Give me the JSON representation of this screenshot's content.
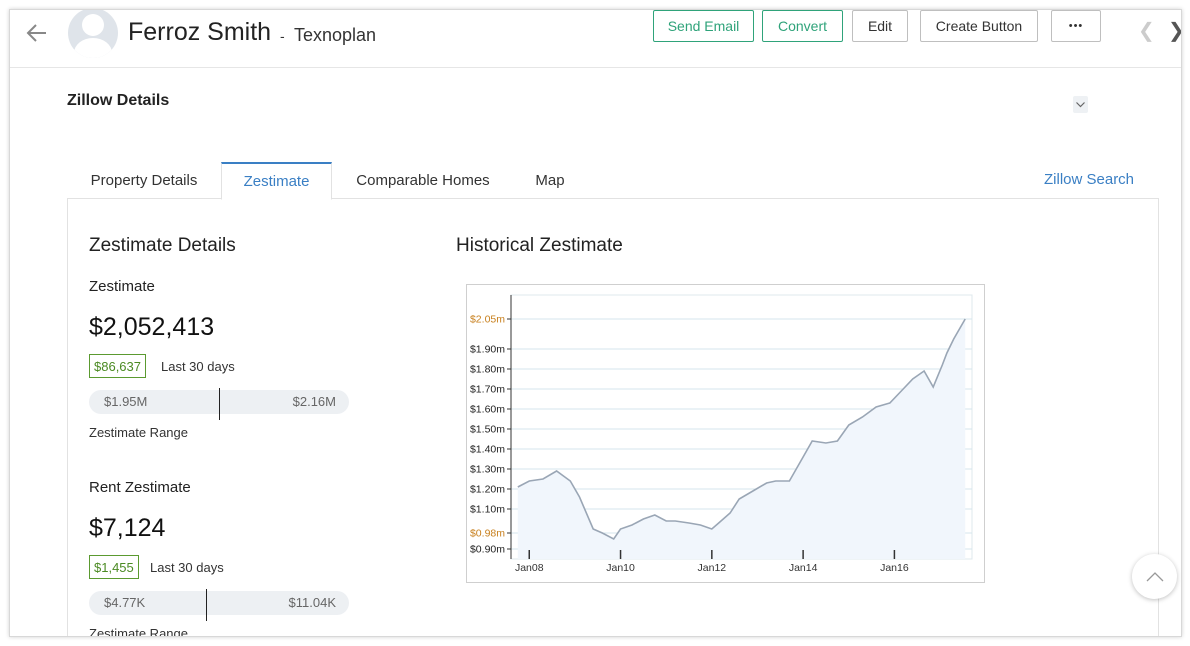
{
  "header": {
    "name": "Ferroz Smith",
    "separator": "-",
    "company": "Texnoplan",
    "buttons": {
      "send_email": "Send Email",
      "convert": "Convert",
      "edit": "Edit",
      "create_button": "Create Button",
      "more": "•••"
    },
    "colors": {
      "accent_green": "#2fa37a",
      "ribbon": "#f29b3a"
    }
  },
  "section": {
    "title": "Zillow Details"
  },
  "tabs": [
    {
      "label": "Property Details",
      "active": false
    },
    {
      "label": "Zestimate",
      "active": true
    },
    {
      "label": "Comparable Homes",
      "active": false
    },
    {
      "label": "Map",
      "active": false
    }
  ],
  "zillow_search": "Zillow Search",
  "details": {
    "heading": "Zestimate Details",
    "zestimate": {
      "label": "Zestimate",
      "value": "$2,052,413",
      "change": "$86,637",
      "period": "Last 30 days",
      "range_low": "$1.95M",
      "range_high": "$2.16M",
      "range_position": 0.5,
      "range_label": "Zestimate Range"
    },
    "rent": {
      "label": "Rent Zestimate",
      "value": "$7,124",
      "change": "$1,455",
      "period": "Last 30 days",
      "range_low": "$4.77K",
      "range_high": "$11.04K",
      "range_position": 0.45,
      "range_label": "Zestimate Range"
    }
  },
  "chart": {
    "heading": "Historical Zestimate"
  },
  "chart_data": {
    "type": "area",
    "title": "Historical Zestimate",
    "xlabel": "",
    "ylabel": "",
    "x_ticks": [
      "Jan08",
      "Jan10",
      "Jan12",
      "Jan14",
      "Jan16"
    ],
    "y_ticks": [
      "$0.90m",
      "$1.10m",
      "$1.20m",
      "$1.30m",
      "$1.40m",
      "$1.50m",
      "$1.60m",
      "$1.70m",
      "$1.80m",
      "$1.90m"
    ],
    "highlight_ticks": [
      "$0.98m",
      "$2.05m"
    ],
    "ylim": [
      0.85,
      2.17
    ],
    "xlim": [
      2007.6,
      2017.7
    ],
    "grid": true,
    "colors": {
      "line": "#9aa6b5",
      "fill": "#f1f6fc",
      "grid": "#d5e6ec",
      "highlight": "#c8801e"
    },
    "x": [
      2007.75,
      2008.0,
      2008.3,
      2008.6,
      2008.9,
      2009.1,
      2009.4,
      2009.6,
      2009.85,
      2010.0,
      2010.25,
      2010.5,
      2010.75,
      2011.0,
      2011.2,
      2011.5,
      2011.75,
      2012.0,
      2012.15,
      2012.4,
      2012.6,
      2012.9,
      2013.2,
      2013.4,
      2013.7,
      2014.0,
      2014.2,
      2014.5,
      2014.75,
      2015.0,
      2015.3,
      2015.6,
      2015.9,
      2016.15,
      2016.4,
      2016.65,
      2016.85,
      2017.05,
      2017.15,
      2017.3,
      2017.55
    ],
    "y": [
      1.21,
      1.24,
      1.25,
      1.29,
      1.24,
      1.16,
      1.0,
      0.98,
      0.95,
      1.0,
      1.02,
      1.05,
      1.07,
      1.04,
      1.04,
      1.03,
      1.02,
      1.0,
      1.03,
      1.08,
      1.15,
      1.19,
      1.23,
      1.24,
      1.24,
      1.36,
      1.44,
      1.43,
      1.44,
      1.52,
      1.56,
      1.61,
      1.63,
      1.69,
      1.75,
      1.79,
      1.71,
      1.82,
      1.88,
      1.95,
      2.05
    ]
  }
}
